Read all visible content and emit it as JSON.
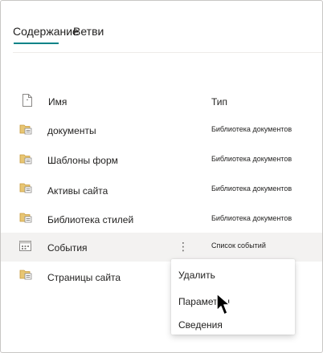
{
  "tabs": [
    {
      "label": "Содержание",
      "active": true
    },
    {
      "label": "Ветви",
      "active": false
    }
  ],
  "accent_color": "#038387",
  "table": {
    "headers": {
      "name": "Имя",
      "type": "Тип",
      "icon": "file-icon"
    },
    "rows": [
      {
        "name": "документы",
        "type": "Библиотека документов",
        "icon": "document-library-icon"
      },
      {
        "name": "Шаблоны форм",
        "type": "Библиотека документов",
        "icon": "document-library-icon"
      },
      {
        "name": "Активы сайта",
        "type": "Библиотека документов",
        "icon": "document-library-icon"
      },
      {
        "name": "Библиотека стилей",
        "type": "Библиотека документов",
        "icon": "document-library-icon"
      },
      {
        "name": "События",
        "type": "Список событий",
        "icon": "calendar-icon",
        "selected": true
      },
      {
        "name": "Страницы сайта",
        "type": "",
        "icon": "document-library-icon"
      }
    ]
  },
  "context_menu": {
    "items": [
      "Удалить",
      "Параметры",
      "Сведения"
    ]
  }
}
